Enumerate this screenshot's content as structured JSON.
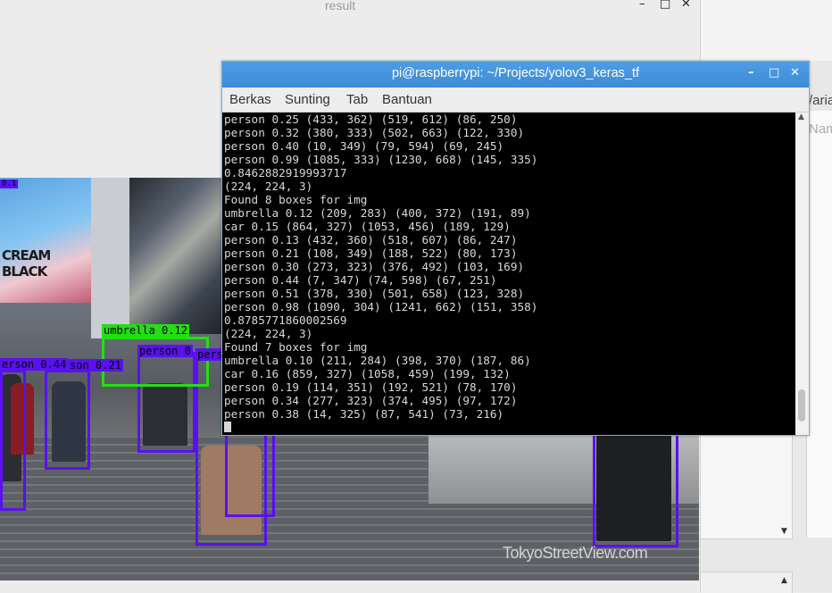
{
  "result_window": {
    "title": "result",
    "minimize": "–",
    "maximize": "□",
    "close": "✕"
  },
  "right_app": {
    "label": "/aria",
    "column": "Nam"
  },
  "street": {
    "billboard_text": "CREAM BLACK",
    "watermark": "TokyoStreetView.com",
    "top_label": "0.1",
    "detections": [
      {
        "label": "umbrella 0.12",
        "class": "umbrella"
      },
      {
        "label": "person 0",
        "class": "person"
      },
      {
        "label": "pers",
        "class": "person"
      },
      {
        "label": "erson 0.44",
        "class": "person"
      },
      {
        "label": "son 0.21",
        "class": "person"
      }
    ]
  },
  "terminal": {
    "title": "pi@raspberrypi: ~/Projects/yolov3_keras_tf",
    "menu": [
      "Berkas",
      "Sunting",
      "Tab",
      "Bantuan"
    ],
    "lines": [
      "person 0.25 (433, 362) (519, 612) (86, 250)",
      "person 0.32 (380, 333) (502, 663) (122, 330)",
      "person 0.40 (10, 349) (79, 594) (69, 245)",
      "person 0.99 (1085, 333) (1230, 668) (145, 335)",
      "0.8462882919993717",
      "(224, 224, 3)",
      "Found 8 boxes for img",
      "umbrella 0.12 (209, 283) (400, 372) (191, 89)",
      "car 0.15 (864, 327) (1053, 456) (189, 129)",
      "person 0.13 (432, 360) (518, 607) (86, 247)",
      "person 0.21 (108, 349) (188, 522) (80, 173)",
      "person 0.30 (273, 323) (376, 492) (103, 169)",
      "person 0.44 (7, 347) (74, 598) (67, 251)",
      "person 0.51 (378, 330) (501, 658) (123, 328)",
      "person 0.98 (1090, 304) (1241, 662) (151, 358)",
      "0.8785771860002569",
      "(224, 224, 3)",
      "Found 7 boxes for img",
      "umbrella 0.10 (211, 284) (398, 370) (187, 86)",
      "car 0.16 (859, 327) (1058, 459) (199, 132)",
      "person 0.19 (114, 351) (192, 521) (78, 170)",
      "person 0.34 (277, 323) (374, 495) (97, 172)",
      "person 0.38 (14, 325) (87, 541) (73, 216)"
    ]
  },
  "colors": {
    "terminal_titlebar": "#3e8ad6",
    "bbox_person": "#5a10f0",
    "bbox_umbrella": "#21e011"
  }
}
